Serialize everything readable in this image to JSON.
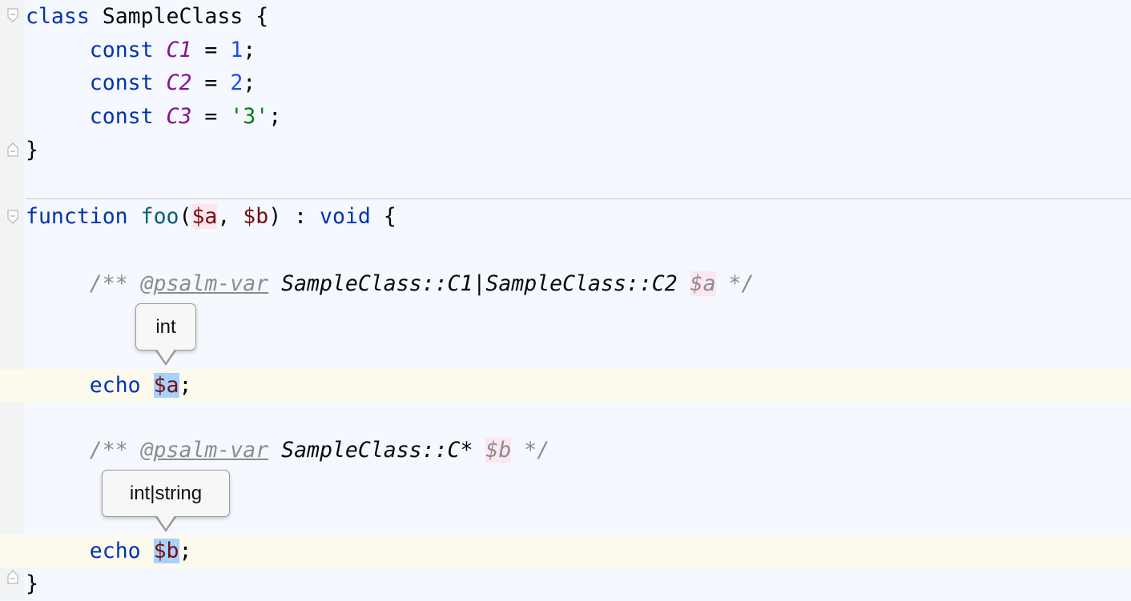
{
  "code": {
    "l0": {
      "kw": "class",
      "name": " SampleClass {"
    },
    "l1": {
      "kw": "const",
      "name": "C1",
      "eq": " = ",
      "val": "1",
      "end": ";"
    },
    "l2": {
      "kw": "const",
      "name": "C2",
      "eq": " = ",
      "val": "2",
      "end": ";"
    },
    "l3": {
      "kw": "const",
      "name": "C3",
      "eq": " = ",
      "val": "'3'",
      "end": ";"
    },
    "l4": "}",
    "l6": {
      "kw": "function",
      "fn": "foo",
      "open": "(",
      "a": "$a",
      "comma": ", ",
      "b": "$b",
      "close": ") : ",
      "void": "void",
      "brace": " {"
    },
    "l8": {
      "open": "/** ",
      "tag": "@psalm-var",
      "type": " SampleClass::C1|SampleClass::C2 ",
      "var": "$a",
      "close": " */"
    },
    "l11": {
      "kw": "echo",
      "var": "$a",
      "end": ";"
    },
    "l13": {
      "open": "/** ",
      "tag": "@psalm-var",
      "type": " SampleClass::C* ",
      "var": "$b",
      "close": " */"
    },
    "l16": {
      "kw": "echo",
      "var": "$b",
      "end": ";"
    },
    "l17": "}"
  },
  "tooltips": {
    "a": "int",
    "b": "int|string"
  },
  "colors": {
    "keyword": "#0033b3",
    "constant": "#871094",
    "number": "#1750eb",
    "string": "#067d17",
    "variable": "#7a0d0d",
    "function": "#00627a",
    "comment": "#8c8c8c",
    "selection": "#a6d2ff",
    "current_line": "#fcfaed"
  }
}
